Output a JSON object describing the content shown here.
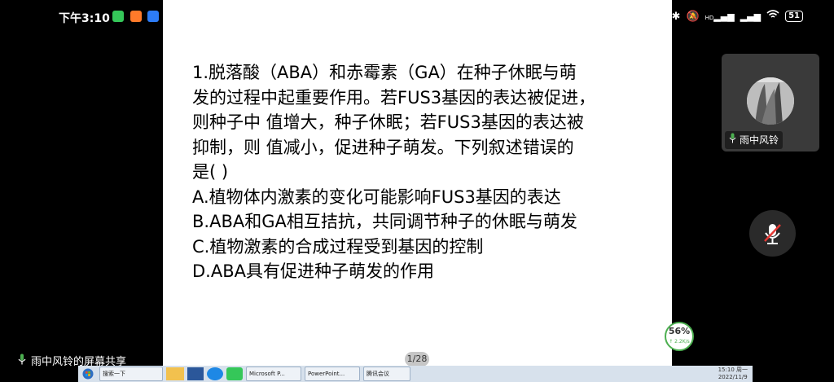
{
  "status_bar": {
    "time": "下午3:10",
    "battery": "51",
    "signal_label": "HD"
  },
  "slide": {
    "question_lines": [
      "1.脱落酸（ABA）和赤霉素（GA）在种子休眠与萌",
      "发的过程中起重要作用。若FUS3基因的表达被促进，",
      "则种子中 值增大，种子休眠；若FUS3基因的表达被",
      "抑制，则 值减小，促进种子萌发。下列叙述错误的",
      "是(     )",
      "A.植物体内激素的变化可能影响FUS3基因的表达",
      "B.ABA和GA相互拮抗，共同调节种子的休眠与萌发",
      "C.植物激素的合成过程受到基因的控制",
      "D.ABA具有促进种子萌发的作用"
    ],
    "page_indicator": "1/28"
  },
  "speaker": {
    "name": "雨中风铃"
  },
  "screen_share_label": "雨中风铃的屏幕共享",
  "progress_widget": {
    "percent": "56%",
    "rate": "↑ 2.2K/s"
  },
  "taskbar": {
    "items": [
      "搜索一下",
      "Microsoft P...",
      "PowerPoint...",
      "腾讯会议"
    ],
    "clock_time": "15:10 周一",
    "clock_date": "2022/11/9"
  },
  "colors": {
    "accent_green": "#4caf50",
    "mute_red": "#e53935",
    "panel_bg": "#3a3a3a"
  }
}
